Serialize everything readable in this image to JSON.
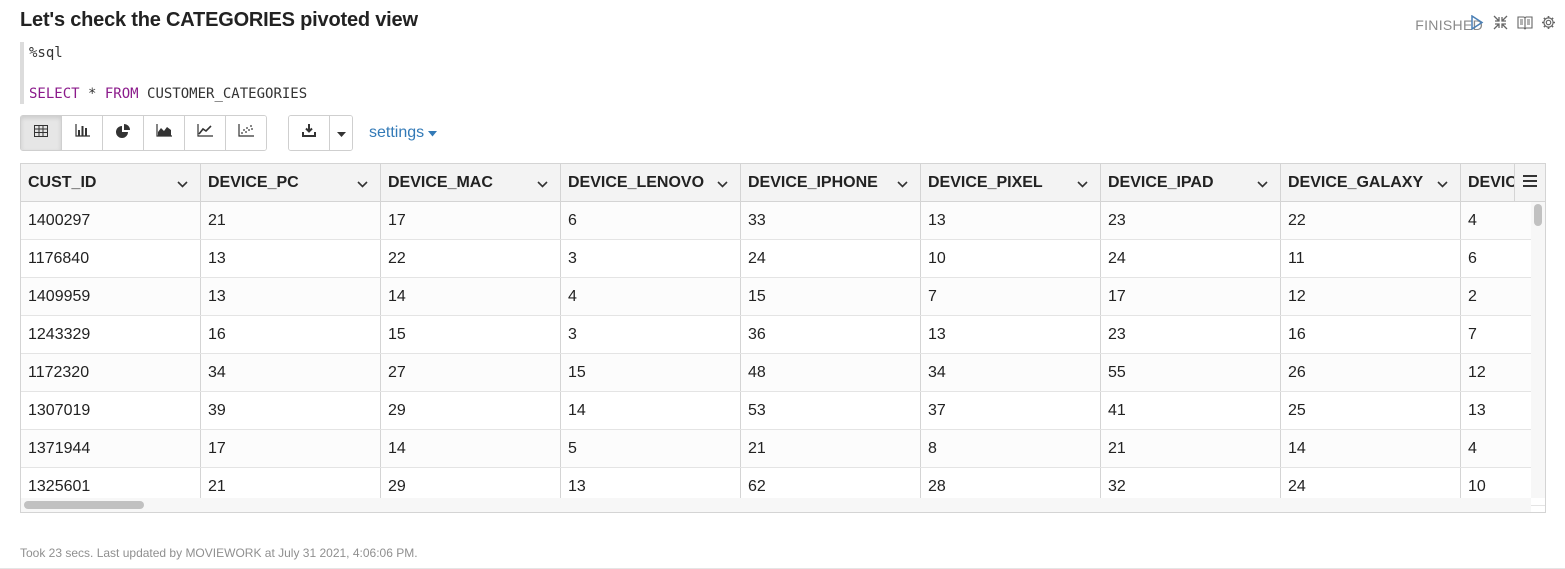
{
  "paragraph": {
    "title": "Let's check the CATEGORIES pivoted view",
    "status": "FINISHED",
    "icons": [
      "run-icon",
      "collapse-icon",
      "book-icon",
      "gear-icon"
    ]
  },
  "editor": {
    "interpreter": "%sql",
    "query_keyword_select": "SELECT",
    "query_star": " * ",
    "query_keyword_from": "FROM",
    "query_table": " CUSTOMER_CATEGORIES"
  },
  "toolbar": {
    "view_icons": [
      "table-icon",
      "bar-chart-icon",
      "pie-chart-icon",
      "area-chart-icon",
      "line-chart-icon",
      "scatter-chart-icon"
    ],
    "active_view": "table-icon",
    "download_icon": "download-icon",
    "settings_label": "settings"
  },
  "table": {
    "columns": [
      "CUST_ID",
      "DEVICE_PC",
      "DEVICE_MAC",
      "DEVICE_LENOVO",
      "DEVICE_IPHONE",
      "DEVICE_PIXEL",
      "DEVICE_IPAD",
      "DEVICE_GALAXY",
      "DEVICE_"
    ],
    "rows": [
      [
        "1400297",
        "21",
        "17",
        "6",
        "33",
        "13",
        "23",
        "22",
        "4"
      ],
      [
        "1176840",
        "13",
        "22",
        "3",
        "24",
        "10",
        "24",
        "11",
        "6"
      ],
      [
        "1409959",
        "13",
        "14",
        "4",
        "15",
        "7",
        "17",
        "12",
        "2"
      ],
      [
        "1243329",
        "16",
        "15",
        "3",
        "36",
        "13",
        "23",
        "16",
        "7"
      ],
      [
        "1172320",
        "34",
        "27",
        "15",
        "48",
        "34",
        "55",
        "26",
        "12"
      ],
      [
        "1307019",
        "39",
        "29",
        "14",
        "53",
        "37",
        "41",
        "25",
        "13"
      ],
      [
        "1371944",
        "17",
        "14",
        "5",
        "21",
        "8",
        "21",
        "14",
        "4"
      ],
      [
        "1325601",
        "21",
        "29",
        "13",
        "62",
        "28",
        "32",
        "24",
        "10"
      ]
    ]
  },
  "footer": {
    "text": "Took 23 secs. Last updated by MOVIEWORK at July 31 2021, 4:06:06 PM."
  },
  "colors": {
    "keyword": "#8b1a8b",
    "link": "#337ab7",
    "status": "#8a8a8a"
  }
}
